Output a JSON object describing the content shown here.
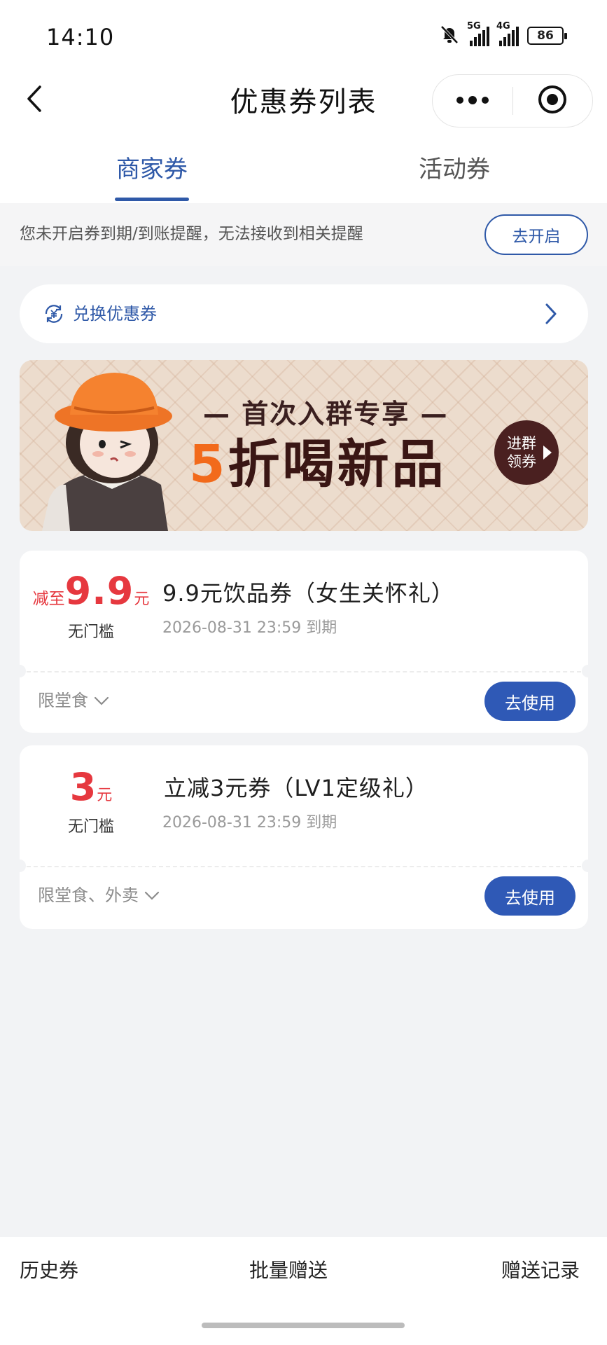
{
  "status_bar": {
    "time": "14:10",
    "mute_icon": "bell-off-icon",
    "signal_1": "5G",
    "signal_2": "4G",
    "battery": "86"
  },
  "nav": {
    "title": "优惠券列表",
    "back_icon": "chevron-left-icon",
    "more_icon": "more-dots-icon",
    "close_icon": "target-circle-icon"
  },
  "tabs": [
    {
      "label": "商家券",
      "active": true
    },
    {
      "label": "活动券",
      "active": false
    }
  ],
  "reminder": {
    "text": "您未开启券到期/到账提醒，无法接收到相关提醒",
    "button": "去开启"
  },
  "redeem": {
    "label": "兑换优惠券",
    "icon": "exchange-coupon-icon"
  },
  "banner": {
    "subtitle": "— 首次入群专享 —",
    "headline_num": "5",
    "headline_rest": "折喝新品",
    "badge": "进群领券"
  },
  "coupons": [
    {
      "prefix": "减至",
      "value": "9.9",
      "unit": "元",
      "threshold": "无门槛",
      "title": "9.9元饮品券（女生关怀礼）",
      "expiry": "2026-08-31 23:59 到期",
      "scope": "限堂食",
      "button": "去使用"
    },
    {
      "prefix": "",
      "value": "3",
      "unit": "元",
      "threshold": "无门槛",
      "title": "立减3元券（LV1定级礼）",
      "expiry": "2026-08-31 23:59 到期",
      "scope": "限堂食、外卖",
      "button": "去使用"
    }
  ],
  "bottom_bar": {
    "history": "历史券",
    "batch_gift": "批量赠送",
    "gift_records": "赠送记录"
  },
  "colors": {
    "accent": "#2f59a8",
    "price_red": "#e6383f",
    "banner_orange": "#f26a1b",
    "banner_brown": "#3a1614"
  }
}
